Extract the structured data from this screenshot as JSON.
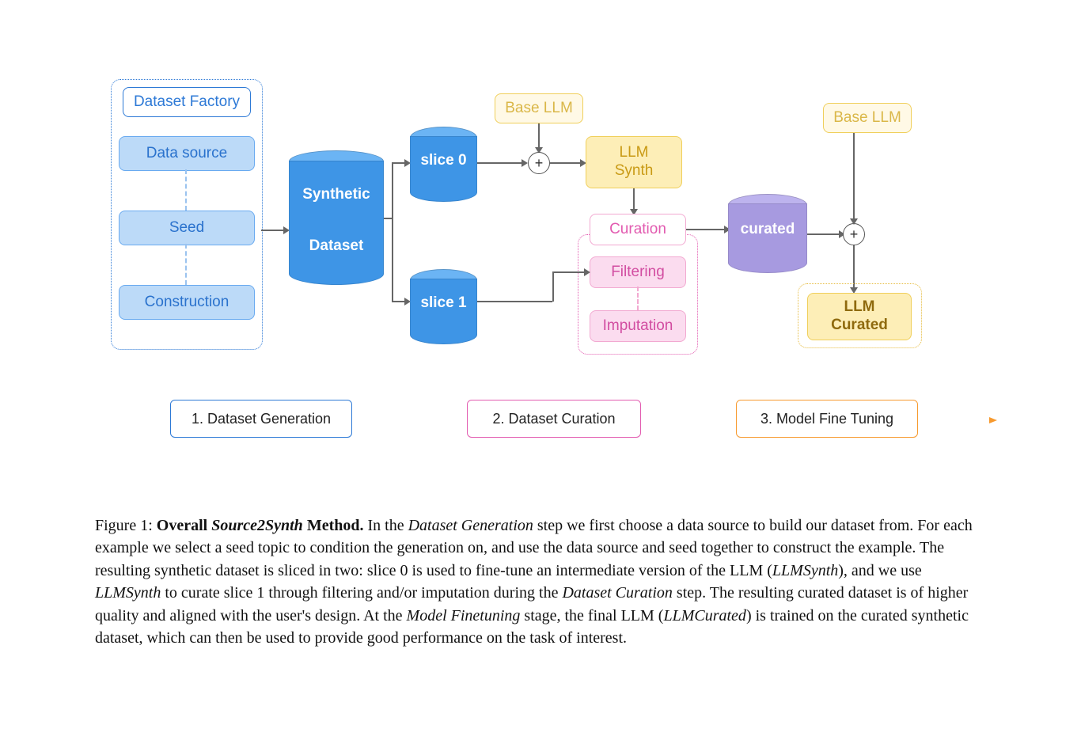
{
  "factory": {
    "title": "Dataset Factory",
    "items": [
      "Data source",
      "Seed",
      "Construction"
    ]
  },
  "cylinders": {
    "synthetic": {
      "line1": "Synthetic",
      "line2": "Dataset"
    },
    "slice0": "slice 0",
    "slice1": "slice 1",
    "curated": "curated"
  },
  "yellow": {
    "base_llm_1": "Base LLM",
    "base_llm_2": "Base LLM",
    "llm_synth": "LLM\nSynth",
    "llm_curated": "LLM\nCurated"
  },
  "pink": {
    "curation": "Curation",
    "filtering": "Filtering",
    "imputation": "Imputation"
  },
  "stages": {
    "s1": "1. Dataset Generation",
    "s2": "2. Dataset Curation",
    "s3": "3. Model Fine Tuning"
  },
  "caption": {
    "figlabel": "Figure 1: ",
    "title_bold": "Overall ",
    "title_italic": "Source2Synth",
    "title_after": " Method.",
    "body": " In the Dataset Generation step we first choose a data source to build our dataset from. For each example we select a seed topic to condition the generation on, and use the data source and seed together to construct the example. The resulting synthetic dataset is sliced in two: slice 0 is used to fine-tune an intermediate version of the LLM (LLMSynth), and we use LLMSynth to curate slice 1 through filtering and/or imputation during the Dataset Curation step. The resulting curated dataset is of higher quality and aligned with the user's design. At the Model Finetuning stage, the final LLM (LLMCurated) is trained on the curated synthetic dataset, which can then be used to provide good performance on the task of interest."
  },
  "colors": {
    "blue": "#3e95e6",
    "blue_dark": "#2d79d6",
    "yellow": "#fdeeb7",
    "pink": "#fbdcef",
    "purple": "#a79ae0",
    "orange": "#f79a2f"
  }
}
